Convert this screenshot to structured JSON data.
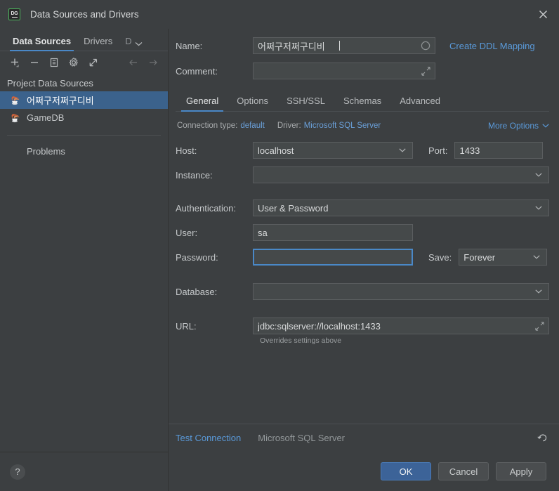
{
  "window": {
    "title": "Data Sources and Drivers",
    "logo_text": "DG",
    "close_icon": "close-icon"
  },
  "sidebar": {
    "tabs": [
      {
        "label": "Data Sources",
        "active": true
      },
      {
        "label": "Drivers",
        "active": false
      },
      {
        "label": "D",
        "active": false,
        "truncated": true
      }
    ],
    "toolbar": [
      {
        "name": "add-button",
        "icon": "plus-icon"
      },
      {
        "name": "remove-button",
        "icon": "minus-icon"
      },
      {
        "name": "duplicate-button",
        "icon": "copy-icon"
      },
      {
        "name": "settings-button",
        "icon": "gear-icon"
      },
      {
        "name": "share-button",
        "icon": "external-link-icon"
      },
      {
        "name": "back-button",
        "icon": "arrow-left-icon"
      },
      {
        "name": "forward-button",
        "icon": "arrow-right-icon"
      }
    ],
    "group_label": "Project Data Sources",
    "items": [
      {
        "label": "어쩌구저쩌구디비",
        "selected": true
      },
      {
        "label": "GameDB",
        "selected": false
      }
    ],
    "problems_label": "Problems",
    "help_label": "?"
  },
  "form": {
    "name_label": "Name:",
    "name_value": "어쩌구저쩌구디비",
    "name_color_icon": "circle-icon",
    "create_ddl_mapping": "Create DDL Mapping",
    "comment_label": "Comment:",
    "comment_value": "",
    "comment_expand_icon": "expand-icon",
    "tabs": [
      {
        "label": "General",
        "active": true
      },
      {
        "label": "Options",
        "active": false
      },
      {
        "label": "SSH/SSL",
        "active": false
      },
      {
        "label": "Schemas",
        "active": false
      },
      {
        "label": "Advanced",
        "active": false
      }
    ],
    "connection_type_label": "Connection type:",
    "connection_type_value": "default",
    "driver_label": "Driver:",
    "driver_value": "Microsoft SQL Server",
    "more_options_label": "More Options",
    "host_label": "Host:",
    "host_value": "localhost",
    "port_label": "Port:",
    "port_value": "1433",
    "instance_label": "Instance:",
    "instance_value": "",
    "authentication_label": "Authentication:",
    "authentication_value": "User & Password",
    "user_label": "User:",
    "user_value": "sa",
    "password_label": "Password:",
    "password_value": "",
    "save_label": "Save:",
    "save_value": "Forever",
    "database_label": "Database:",
    "database_value": "",
    "url_label": "URL:",
    "url_value": "jdbc:sqlserver://localhost:1433",
    "url_expand_icon": "expand-icon",
    "url_hint": "Overrides settings above"
  },
  "footer": {
    "test_connection": "Test Connection",
    "driver_status": "Microsoft SQL Server",
    "revert_icon": "revert-icon",
    "ok": "OK",
    "cancel": "Cancel",
    "apply": "Apply"
  },
  "colors": {
    "accent": "#4a88c7",
    "link": "#5a9ada",
    "selection": "#3b628c",
    "window_bg": "#3c3f41",
    "field_bg": "#45494a"
  }
}
